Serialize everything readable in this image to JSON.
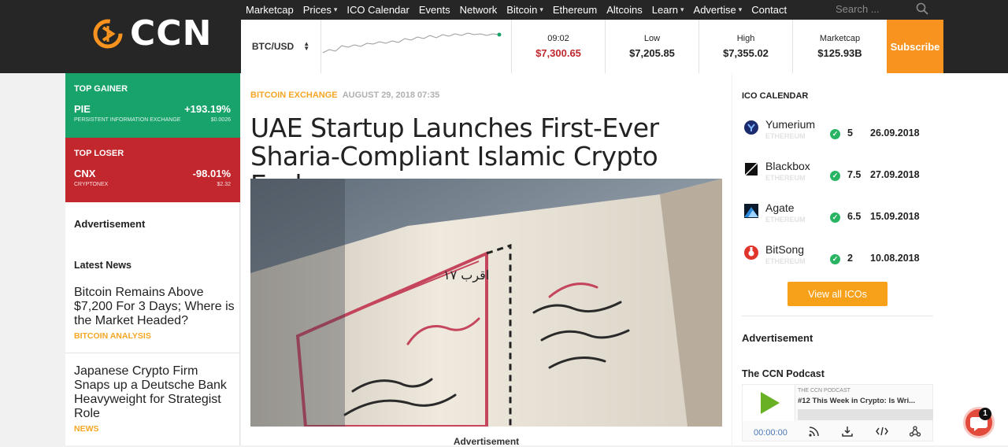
{
  "brand": {
    "name": "CCN"
  },
  "nav": {
    "items": [
      {
        "label": "Marketcap",
        "dropdown": false
      },
      {
        "label": "Prices",
        "dropdown": true
      },
      {
        "label": "ICO Calendar",
        "dropdown": false
      },
      {
        "label": "Events",
        "dropdown": false
      },
      {
        "label": "Network",
        "dropdown": false
      },
      {
        "label": "Bitcoin",
        "dropdown": true
      },
      {
        "label": "Ethereum",
        "dropdown": false
      },
      {
        "label": "Altcoins",
        "dropdown": false
      },
      {
        "label": "Learn",
        "dropdown": true
      },
      {
        "label": "Advertise",
        "dropdown": true
      },
      {
        "label": "Contact",
        "dropdown": false
      }
    ],
    "search_placeholder": "Search ..."
  },
  "ticker": {
    "pair": "BTC/USD",
    "time_label": "09:02",
    "price": "$7,300.65",
    "low_label": "Low",
    "low": "$7,205.85",
    "high_label": "High",
    "high": "$7,355.02",
    "marketcap_label": "Marketcap",
    "marketcap": "$125.93B",
    "subscribe": "Subscribe"
  },
  "left": {
    "gainer": {
      "title": "TOP GAINER",
      "symbol": "PIE",
      "change": "+193.19%",
      "name": "PERSISTENT INFORMATION EXCHANGE",
      "price": "$0.0026"
    },
    "loser": {
      "title": "TOP LOSER",
      "symbol": "CNX",
      "change": "-98.01%",
      "name": "CRYPTONEX",
      "price": "$2.32"
    },
    "advertisement": "Advertisement",
    "latest_news_title": "Latest News",
    "news": [
      {
        "title": "Bitcoin Remains Above $7,200 For 3 Days; Where is the Market Headed?",
        "tag": "BITCOIN ANALYSIS"
      },
      {
        "title": "Japanese Crypto Firm Snaps up a Deutsche Bank Heavyweight for Strategist Role",
        "tag": "NEWS"
      }
    ]
  },
  "article": {
    "category": "BITCOIN EXCHANGE",
    "date": "AUGUST 29, 2018 07:35",
    "headline": "UAE Startup Launches First-Ever Sharia-Compliant Islamic Crypto Exchange",
    "image_text": "اقرب ١٧",
    "advertisement": "Advertisement"
  },
  "right": {
    "ico_title": "ICO CALENDAR",
    "icos": [
      {
        "name": "Yumerium",
        "chain": "ETHEREUM",
        "score": "5",
        "date": "26.09.2018",
        "logo_color": "#1c2a6e"
      },
      {
        "name": "Blackbox",
        "chain": "ETHEREUM",
        "score": "7.5",
        "date": "27.09.2018",
        "logo_color": "#111111"
      },
      {
        "name": "Agate",
        "chain": "ETHEREUM",
        "score": "6.5",
        "date": "15.09.2018",
        "logo_color": "#1f5fa8"
      },
      {
        "name": "BitSong",
        "chain": "ETHEREUM",
        "score": "2",
        "date": "10.08.2018",
        "logo_color": "#e0352b"
      }
    ],
    "view_all": "View all ICOs",
    "advertisement": "Advertisement",
    "podcast_title": "The CCN Podcast",
    "podcast": {
      "show": "THE CCN PODCAST",
      "episode": "#12 This Week in Crypto: Is Wri...",
      "time": "00:00:00"
    }
  },
  "chat": {
    "badge": "1"
  },
  "colors": {
    "accent": "#f7931e",
    "gainer": "#18a36b",
    "loser": "#c1272d",
    "tag": "#f5a623"
  }
}
